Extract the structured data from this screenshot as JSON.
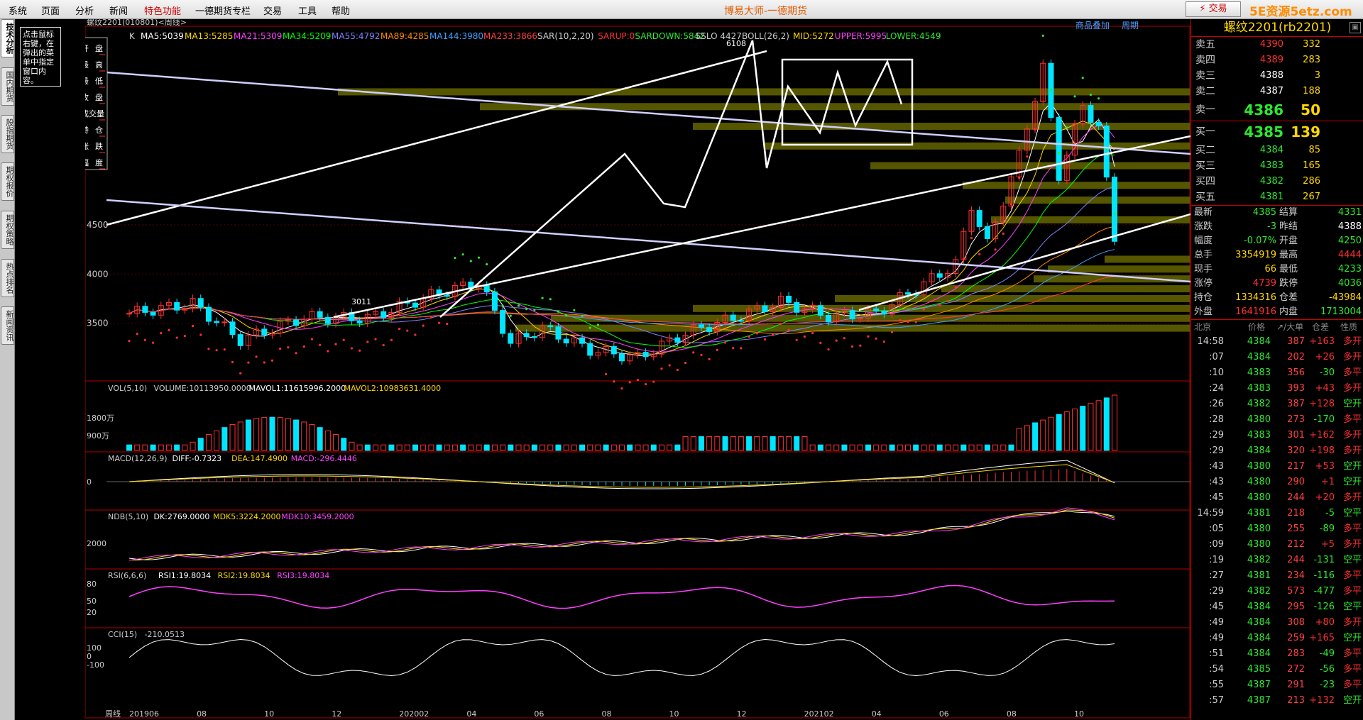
{
  "menu": [
    "系统",
    "页面",
    "分析",
    "新闻",
    "特色功能",
    "一德期货专栏",
    "交易",
    "工具",
    "帮助"
  ],
  "brand": "博易大师-一德期货",
  "trade_btn": "⚡ 交易",
  "site": "5E资源5etz.com",
  "left_tabs": [
    "技术分析",
    "国内期货",
    "股指期货",
    "期权报价",
    "期权策略",
    "热点排名",
    "新闻资讯"
  ],
  "hint": "点击鼠标右键，在弹出的菜单中指定窗口内容。",
  "chart": {
    "title": "螺纹2201(010801)<周线>",
    "links": [
      "商品叠加",
      "周期"
    ],
    "row_label": "K",
    "ma": [
      {
        "t": "MA5:5039",
        "c": "#ffffff"
      },
      {
        "t": "MA13:5285",
        "c": "#ffd700"
      },
      {
        "t": "MA21:5309",
        "c": "#ff40ff"
      },
      {
        "t": "MA34:5209",
        "c": "#00ff00"
      },
      {
        "t": "MA55:4792",
        "c": "#8080ff"
      },
      {
        "t": "MA89:4285",
        "c": "#ff8c00"
      },
      {
        "t": "MA144:3980",
        "c": "#40a0ff"
      },
      {
        "t": "MA233:3866",
        "c": "#ff4040"
      }
    ],
    "sar": [
      {
        "t": "SAR(10,2,20)",
        "c": "#cccccc"
      },
      {
        "t": "SARUP:0",
        "c": "#ff3030"
      },
      {
        "t": "SARDOWN:5842",
        "c": "#2ee82e"
      },
      {
        "t": "SSLO 4427",
        "c": "#cccccc"
      },
      {
        "t": "BOLL(26,2)",
        "c": "#cccccc"
      },
      {
        "t": "MID:5272",
        "c": "#ffd700"
      },
      {
        "t": "UPPER:5995",
        "c": "#ff40ff"
      },
      {
        "t": "LOWER:4549",
        "c": "#2ee82e"
      }
    ],
    "price_ticks": [
      {
        "v": 4500,
        "label": "4500"
      },
      {
        "v": 4000,
        "label": "4000"
      },
      {
        "v": 3500,
        "label": "3500"
      }
    ],
    "peak_label": "6108",
    "trough_label": "3011",
    "info_box": [
      "开",
      "盘",
      "最",
      "高",
      "最",
      "低",
      "收",
      "盘",
      "成交量",
      "持",
      "仓",
      "涨",
      "跌",
      "幅",
      "度"
    ],
    "vol": {
      "label": "VOL(5,10)",
      "items": [
        {
          "t": "VOLUME:10113950.0000",
          "c": "#cccccc"
        },
        {
          "t": "MAVOL1:11615996.2000",
          "c": "#ffffff"
        },
        {
          "t": "MAVOL2:10983631.4000",
          "c": "#ffd700"
        }
      ],
      "ticks": [
        "1800万",
        "900万"
      ]
    },
    "macd": {
      "label": "MACD(12,26,9)",
      "items": [
        {
          "t": "DIFF:-0.7323",
          "c": "#ffffff"
        },
        {
          "t": "DEA:147.4900",
          "c": "#ffd700"
        },
        {
          "t": "MACD:-296.4446",
          "c": "#ff40ff"
        }
      ],
      "ticks": [
        "0"
      ]
    },
    "ndb": {
      "label": "NDB(5,10)",
      "items": [
        {
          "t": "DK:2769.0000",
          "c": "#ffffff"
        },
        {
          "t": "MDK5:3224.2000",
          "c": "#ffd700"
        },
        {
          "t": "MDK10:3459.2000",
          "c": "#ff40ff"
        }
      ],
      "ticks": [
        "2000"
      ]
    },
    "rsi": {
      "label": "RSI(6,6,6)",
      "items": [
        {
          "t": "RSI1:19.8034",
          "c": "#ffffff"
        },
        {
          "t": "RSI2:19.8034",
          "c": "#ffd700"
        },
        {
          "t": "RSI3:19.8034",
          "c": "#ff40ff"
        }
      ],
      "ticks": [
        "80",
        "50",
        "20"
      ]
    },
    "cci": {
      "label": "CCI(15)",
      "items": [
        {
          "t": "-210.0513",
          "c": "#cccccc"
        }
      ],
      "ticks": [
        "100",
        "0",
        "-100"
      ]
    },
    "xaxis": {
      "label": "周线",
      "ticks": [
        "201906",
        "08",
        "10",
        "12",
        "202002",
        "04",
        "06",
        "08",
        "10",
        "12",
        "202102",
        "04",
        "06",
        "08",
        "10"
      ]
    }
  },
  "side": {
    "title": "螺纹2201(rb2201)",
    "asks": [
      {
        "l": "卖五",
        "p": "4390",
        "v": "332"
      },
      {
        "l": "卖四",
        "p": "4389",
        "v": "283"
      },
      {
        "l": "卖三",
        "p": "4388",
        "v": "3"
      },
      {
        "l": "卖二",
        "p": "4387",
        "v": "188"
      },
      {
        "l": "卖一",
        "p": "4386",
        "v": "50"
      }
    ],
    "bids": [
      {
        "l": "买一",
        "p": "4385",
        "v": "139"
      },
      {
        "l": "买二",
        "p": "4384",
        "v": "85"
      },
      {
        "l": "买三",
        "p": "4383",
        "v": "165"
      },
      {
        "l": "买四",
        "p": "4382",
        "v": "286"
      },
      {
        "l": "买五",
        "p": "4381",
        "v": "267"
      }
    ],
    "stats": [
      {
        "l1": "最新",
        "v1": "4385",
        "c1": "g",
        "l2": "结算",
        "v2": "4331",
        "c2": "g"
      },
      {
        "l1": "涨跌",
        "v1": "-3",
        "c1": "g",
        "l2": "昨结",
        "v2": "4388",
        "c2": "w"
      },
      {
        "l1": "幅度",
        "v1": "-0.07%",
        "c1": "g",
        "l2": "开盘",
        "v2": "4250",
        "c2": "g"
      },
      {
        "l1": "总手",
        "v1": "3354919",
        "c1": "y",
        "l2": "最高",
        "v2": "4444",
        "c2": "r"
      },
      {
        "l1": "现手",
        "v1": "66",
        "c1": "y",
        "l2": "最低",
        "v2": "4233",
        "c2": "g"
      },
      {
        "l1": "涨停",
        "v1": "4739",
        "c1": "r",
        "l2": "跌停",
        "v2": "4036",
        "c2": "g"
      },
      {
        "l1": "持仓",
        "v1": "1334316",
        "c1": "y",
        "l2": "仓差",
        "v2": "-43984",
        "c2": "y"
      },
      {
        "l1": "外盘",
        "v1": "1641916",
        "c1": "r",
        "l2": "内盘",
        "v2": "1713004",
        "c2": "g"
      }
    ],
    "tick_head": {
      "loc": "北京",
      "price": "价格",
      "vol": "↗/大单",
      "chg": "仓差",
      "type": "性质"
    },
    "ticks": [
      {
        "t": "14:58",
        "p": "4384",
        "v": "387",
        "c": "+163",
        "ty": "多开"
      },
      {
        "t": ":07",
        "p": "4384",
        "v": "202",
        "c": "+26",
        "ty": "多开"
      },
      {
        "t": ":10",
        "p": "4383",
        "v": "356",
        "c": "-30",
        "ty": "多平"
      },
      {
        "t": ":24",
        "p": "4383",
        "v": "393",
        "c": "+43",
        "ty": "多开"
      },
      {
        "t": ":26",
        "p": "4382",
        "v": "387",
        "c": "+128",
        "ty": "空开"
      },
      {
        "t": ":28",
        "p": "4380",
        "v": "273",
        "c": "-170",
        "ty": "多平"
      },
      {
        "t": ":29",
        "p": "4383",
        "v": "301",
        "c": "+162",
        "ty": "多开"
      },
      {
        "t": ":29",
        "p": "4384",
        "v": "320",
        "c": "+198",
        "ty": "多开"
      },
      {
        "t": ":43",
        "p": "4380",
        "v": "217",
        "c": "+53",
        "ty": "空开"
      },
      {
        "t": ":43",
        "p": "4380",
        "v": "290",
        "c": "+1",
        "ty": "空开"
      },
      {
        "t": ":45",
        "p": "4380",
        "v": "244",
        "c": "+20",
        "ty": "多开"
      },
      {
        "t": "14:59",
        "p": "4381",
        "v": "218",
        "c": "-5",
        "ty": "空平"
      },
      {
        "t": ":05",
        "p": "4380",
        "v": "255",
        "c": "-89",
        "ty": "多平"
      },
      {
        "t": ":09",
        "p": "4380",
        "v": "212",
        "c": "+5",
        "ty": "多开"
      },
      {
        "t": ":19",
        "p": "4382",
        "v": "244",
        "c": "-131",
        "ty": "空平"
      },
      {
        "t": ":27",
        "p": "4381",
        "v": "234",
        "c": "-116",
        "ty": "多平"
      },
      {
        "t": ":29",
        "p": "4382",
        "v": "573",
        "c": "-477",
        "ty": "多平"
      },
      {
        "t": ":45",
        "p": "4384",
        "v": "295",
        "c": "-126",
        "ty": "空平"
      },
      {
        "t": ":49",
        "p": "4384",
        "v": "308",
        "c": "+80",
        "ty": "多开"
      },
      {
        "t": ":49",
        "p": "4384",
        "v": "259",
        "c": "+165",
        "ty": "空开"
      },
      {
        "t": ":51",
        "p": "4384",
        "v": "283",
        "c": "-49",
        "ty": "多平"
      },
      {
        "t": ":54",
        "p": "4385",
        "v": "272",
        "c": "-56",
        "ty": "多平"
      },
      {
        "t": ":55",
        "p": "4387",
        "v": "291",
        "c": "-23",
        "ty": "多平"
      },
      {
        "t": ":57",
        "p": "4387",
        "v": "213",
        "c": "+132",
        "ty": "空开"
      }
    ]
  }
}
